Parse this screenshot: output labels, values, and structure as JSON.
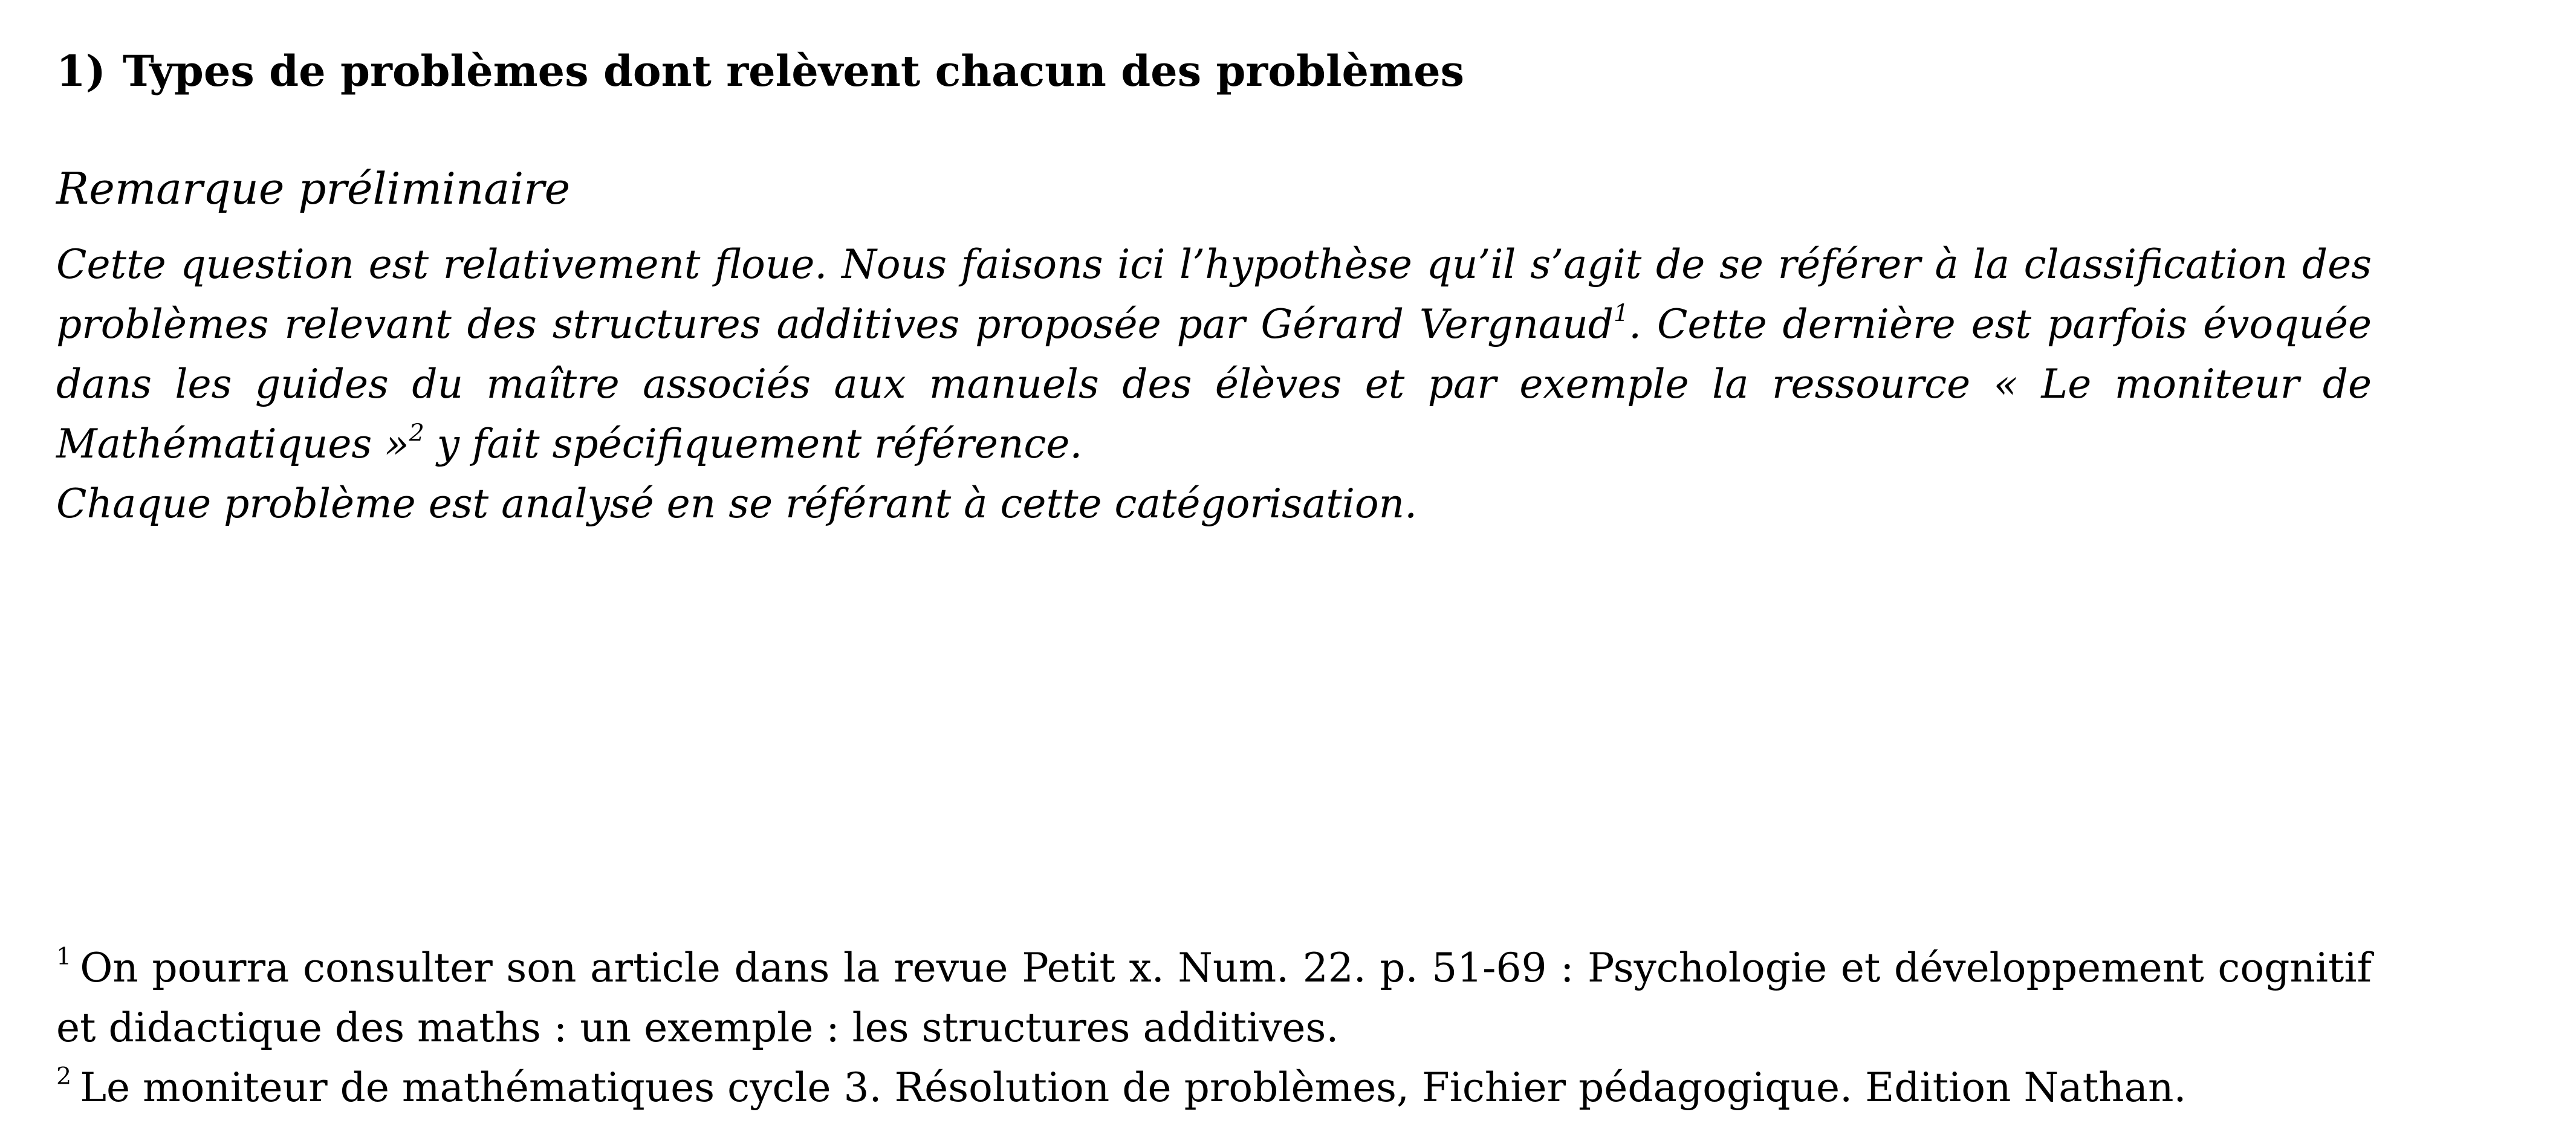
{
  "heading": {
    "number": "1)",
    "title": "Types de problèmes dont relèvent chacun des problèmes"
  },
  "remark": {
    "title": "Remarque préliminaire",
    "paragraph1": {
      "part1": "Cette question est relativement floue. Nous faisons ici l’hypothèse qu’il s’agit de se référer à la classification des problèmes relevant des structures additives proposée par Gérard Vergnaud",
      "ref1": "1",
      "part2": ". Cette dernière est parfois évoquée dans les guides du maître associés aux manuels des élèves et par exemple la ressource « Le moniteur de Mathématiques »",
      "ref2": "2",
      "part3": " y fait spécifiquement référence."
    },
    "paragraph2": "Chaque problème est analysé en se référant à cette catégorisation."
  },
  "footnotes": [
    {
      "mark": "1",
      "text": "On pourra consulter son article dans la revue Petit x. Num. 22. p. 51-69 : Psychologie et développement cognitif et didactique des maths : un exemple : les structures additives."
    },
    {
      "mark": "2",
      "text": "Le moniteur de mathématiques cycle 3. Résolution de problèmes, Fichier pédagogique. Edition Nathan."
    }
  ]
}
